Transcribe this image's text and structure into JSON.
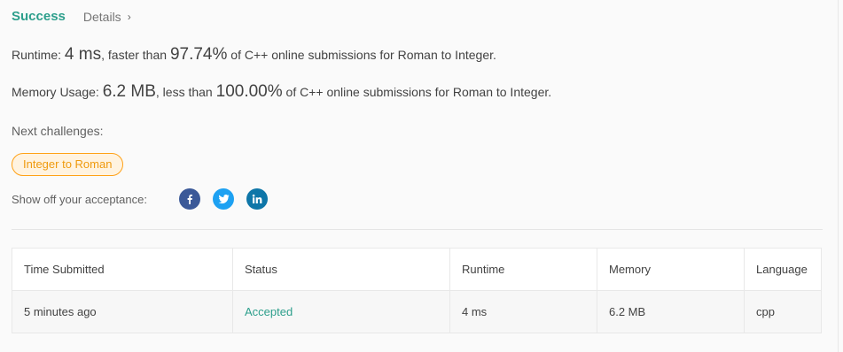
{
  "header": {
    "status": "Success",
    "details_label": "Details",
    "details_chevron": "›"
  },
  "runtime": {
    "label": "Runtime:",
    "value": "4 ms",
    "mid": ", faster than",
    "percent": "97.74%",
    "suffix": "of C++ online submissions for Roman to Integer."
  },
  "memory": {
    "label": "Memory Usage:",
    "value": "6.2 MB",
    "mid": ", less than",
    "percent": "100.00%",
    "suffix": "of C++ online submissions for Roman to Integer."
  },
  "next": {
    "label": "Next challenges:",
    "items": [
      "Integer to Roman"
    ]
  },
  "share": {
    "label": "Show off your acceptance:",
    "icons": [
      "facebook-icon",
      "twitter-icon",
      "linkedin-icon"
    ]
  },
  "table": {
    "headers": [
      "Time Submitted",
      "Status",
      "Runtime",
      "Memory",
      "Language"
    ],
    "rows": [
      [
        "5 minutes ago",
        "Accepted",
        "4 ms",
        "6.2 MB",
        "cpp"
      ]
    ]
  },
  "colors": {
    "accent": "#2d9f8c",
    "tag_border": "#ffa116",
    "facebook": "#3b5998",
    "twitter": "#1da1f2",
    "linkedin": "#0e76a8"
  }
}
